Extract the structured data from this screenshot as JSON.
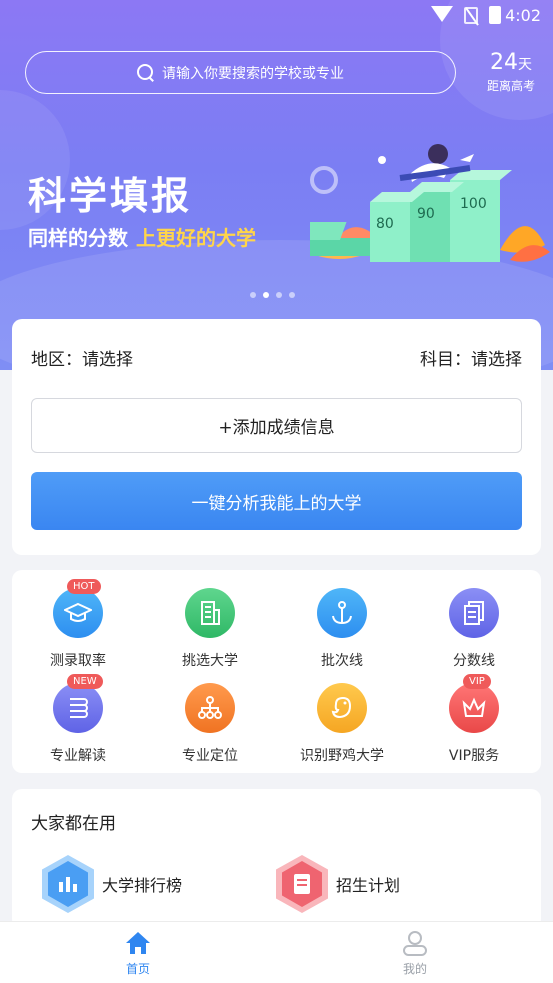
{
  "status_bar": {
    "time": "4:02"
  },
  "header": {
    "search_placeholder": "请输入你要搜索的学校或专业",
    "countdown_number": "24",
    "countdown_unit": "天",
    "countdown_label": "距离高考"
  },
  "banner": {
    "title": "科学填报",
    "subtitle_prefix": "同样的分数",
    "subtitle_highlight": "上更好的大学",
    "book_labels": [
      "80",
      "90",
      "100"
    ],
    "dots_total": 4,
    "dots_active": 2
  },
  "form": {
    "region_label": "地区：请选择",
    "subject_label": "科目：请选择",
    "add_score_button": "+添加成绩信息",
    "analyze_button": "一键分析我能上的大学"
  },
  "tools": [
    {
      "label": "测录取率",
      "icon": "graduation-cap-icon",
      "badge": "HOT",
      "color_top": "#4fb6f8",
      "color_bottom": "#2d8ef0"
    },
    {
      "label": "挑选大学",
      "icon": "building-icon",
      "badge": "",
      "color_top": "#5fd68e",
      "color_bottom": "#2fb866"
    },
    {
      "label": "批次线",
      "icon": "anchor-icon",
      "badge": "",
      "color_top": "#4fb6f8",
      "color_bottom": "#2d8ef0"
    },
    {
      "label": "分数线",
      "icon": "document-stack-icon",
      "badge": "",
      "color_top": "#8b8ff5",
      "color_bottom": "#5f63e6"
    },
    {
      "label": "专业解读",
      "icon": "book-icon",
      "badge": "NEW",
      "color_top": "#8b8ff5",
      "color_bottom": "#5f63e6"
    },
    {
      "label": "专业定位",
      "icon": "org-chart-icon",
      "badge": "",
      "color_top": "#ff9a4d",
      "color_bottom": "#f07322"
    },
    {
      "label": "识别野鸡大学",
      "icon": "chick-icon",
      "badge": "",
      "color_top": "#ffc94d",
      "color_bottom": "#f5a623"
    },
    {
      "label": "VIP服务",
      "icon": "crown-icon",
      "badge": "VIP",
      "color_top": "#ff7676",
      "color_bottom": "#e94848"
    }
  ],
  "popular": {
    "title": "大家都在用",
    "items": [
      {
        "label": "大学排行榜",
        "icon": "bar-chart-icon",
        "outer": "#a7d3fb",
        "inner": "#4a9ef3"
      },
      {
        "label": "招生计划",
        "icon": "document-icon",
        "outer": "#f9b6bb",
        "inner": "#ef6470"
      }
    ]
  },
  "tabbar": {
    "home_label": "首页",
    "mine_label": "我的",
    "active_color": "#2f86f0",
    "inactive_color": "#9aa0a8"
  }
}
